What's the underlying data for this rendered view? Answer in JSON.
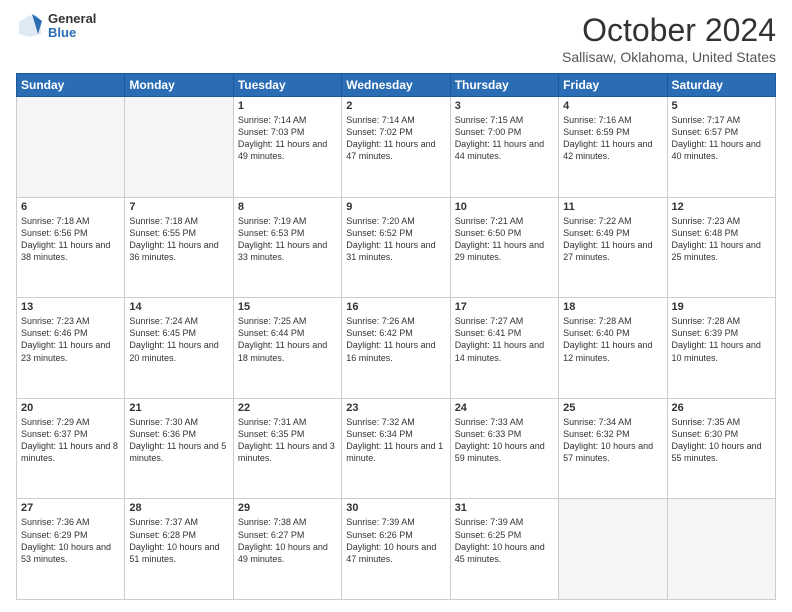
{
  "logo": {
    "general": "General",
    "blue": "Blue"
  },
  "header": {
    "month": "October 2024",
    "location": "Sallisaw, Oklahoma, United States"
  },
  "days_of_week": [
    "Sunday",
    "Monday",
    "Tuesday",
    "Wednesday",
    "Thursday",
    "Friday",
    "Saturday"
  ],
  "weeks": [
    [
      {
        "day": "",
        "sunrise": "",
        "sunset": "",
        "daylight": "",
        "empty": true
      },
      {
        "day": "",
        "sunrise": "",
        "sunset": "",
        "daylight": "",
        "empty": true
      },
      {
        "day": "1",
        "sunrise": "Sunrise: 7:14 AM",
        "sunset": "Sunset: 7:03 PM",
        "daylight": "Daylight: 11 hours and 49 minutes.",
        "empty": false
      },
      {
        "day": "2",
        "sunrise": "Sunrise: 7:14 AM",
        "sunset": "Sunset: 7:02 PM",
        "daylight": "Daylight: 11 hours and 47 minutes.",
        "empty": false
      },
      {
        "day": "3",
        "sunrise": "Sunrise: 7:15 AM",
        "sunset": "Sunset: 7:00 PM",
        "daylight": "Daylight: 11 hours and 44 minutes.",
        "empty": false
      },
      {
        "day": "4",
        "sunrise": "Sunrise: 7:16 AM",
        "sunset": "Sunset: 6:59 PM",
        "daylight": "Daylight: 11 hours and 42 minutes.",
        "empty": false
      },
      {
        "day": "5",
        "sunrise": "Sunrise: 7:17 AM",
        "sunset": "Sunset: 6:57 PM",
        "daylight": "Daylight: 11 hours and 40 minutes.",
        "empty": false
      }
    ],
    [
      {
        "day": "6",
        "sunrise": "Sunrise: 7:18 AM",
        "sunset": "Sunset: 6:56 PM",
        "daylight": "Daylight: 11 hours and 38 minutes.",
        "empty": false
      },
      {
        "day": "7",
        "sunrise": "Sunrise: 7:18 AM",
        "sunset": "Sunset: 6:55 PM",
        "daylight": "Daylight: 11 hours and 36 minutes.",
        "empty": false
      },
      {
        "day": "8",
        "sunrise": "Sunrise: 7:19 AM",
        "sunset": "Sunset: 6:53 PM",
        "daylight": "Daylight: 11 hours and 33 minutes.",
        "empty": false
      },
      {
        "day": "9",
        "sunrise": "Sunrise: 7:20 AM",
        "sunset": "Sunset: 6:52 PM",
        "daylight": "Daylight: 11 hours and 31 minutes.",
        "empty": false
      },
      {
        "day": "10",
        "sunrise": "Sunrise: 7:21 AM",
        "sunset": "Sunset: 6:50 PM",
        "daylight": "Daylight: 11 hours and 29 minutes.",
        "empty": false
      },
      {
        "day": "11",
        "sunrise": "Sunrise: 7:22 AM",
        "sunset": "Sunset: 6:49 PM",
        "daylight": "Daylight: 11 hours and 27 minutes.",
        "empty": false
      },
      {
        "day": "12",
        "sunrise": "Sunrise: 7:23 AM",
        "sunset": "Sunset: 6:48 PM",
        "daylight": "Daylight: 11 hours and 25 minutes.",
        "empty": false
      }
    ],
    [
      {
        "day": "13",
        "sunrise": "Sunrise: 7:23 AM",
        "sunset": "Sunset: 6:46 PM",
        "daylight": "Daylight: 11 hours and 23 minutes.",
        "empty": false
      },
      {
        "day": "14",
        "sunrise": "Sunrise: 7:24 AM",
        "sunset": "Sunset: 6:45 PM",
        "daylight": "Daylight: 11 hours and 20 minutes.",
        "empty": false
      },
      {
        "day": "15",
        "sunrise": "Sunrise: 7:25 AM",
        "sunset": "Sunset: 6:44 PM",
        "daylight": "Daylight: 11 hours and 18 minutes.",
        "empty": false
      },
      {
        "day": "16",
        "sunrise": "Sunrise: 7:26 AM",
        "sunset": "Sunset: 6:42 PM",
        "daylight": "Daylight: 11 hours and 16 minutes.",
        "empty": false
      },
      {
        "day": "17",
        "sunrise": "Sunrise: 7:27 AM",
        "sunset": "Sunset: 6:41 PM",
        "daylight": "Daylight: 11 hours and 14 minutes.",
        "empty": false
      },
      {
        "day": "18",
        "sunrise": "Sunrise: 7:28 AM",
        "sunset": "Sunset: 6:40 PM",
        "daylight": "Daylight: 11 hours and 12 minutes.",
        "empty": false
      },
      {
        "day": "19",
        "sunrise": "Sunrise: 7:28 AM",
        "sunset": "Sunset: 6:39 PM",
        "daylight": "Daylight: 11 hours and 10 minutes.",
        "empty": false
      }
    ],
    [
      {
        "day": "20",
        "sunrise": "Sunrise: 7:29 AM",
        "sunset": "Sunset: 6:37 PM",
        "daylight": "Daylight: 11 hours and 8 minutes.",
        "empty": false
      },
      {
        "day": "21",
        "sunrise": "Sunrise: 7:30 AM",
        "sunset": "Sunset: 6:36 PM",
        "daylight": "Daylight: 11 hours and 5 minutes.",
        "empty": false
      },
      {
        "day": "22",
        "sunrise": "Sunrise: 7:31 AM",
        "sunset": "Sunset: 6:35 PM",
        "daylight": "Daylight: 11 hours and 3 minutes.",
        "empty": false
      },
      {
        "day": "23",
        "sunrise": "Sunrise: 7:32 AM",
        "sunset": "Sunset: 6:34 PM",
        "daylight": "Daylight: 11 hours and 1 minute.",
        "empty": false
      },
      {
        "day": "24",
        "sunrise": "Sunrise: 7:33 AM",
        "sunset": "Sunset: 6:33 PM",
        "daylight": "Daylight: 10 hours and 59 minutes.",
        "empty": false
      },
      {
        "day": "25",
        "sunrise": "Sunrise: 7:34 AM",
        "sunset": "Sunset: 6:32 PM",
        "daylight": "Daylight: 10 hours and 57 minutes.",
        "empty": false
      },
      {
        "day": "26",
        "sunrise": "Sunrise: 7:35 AM",
        "sunset": "Sunset: 6:30 PM",
        "daylight": "Daylight: 10 hours and 55 minutes.",
        "empty": false
      }
    ],
    [
      {
        "day": "27",
        "sunrise": "Sunrise: 7:36 AM",
        "sunset": "Sunset: 6:29 PM",
        "daylight": "Daylight: 10 hours and 53 minutes.",
        "empty": false
      },
      {
        "day": "28",
        "sunrise": "Sunrise: 7:37 AM",
        "sunset": "Sunset: 6:28 PM",
        "daylight": "Daylight: 10 hours and 51 minutes.",
        "empty": false
      },
      {
        "day": "29",
        "sunrise": "Sunrise: 7:38 AM",
        "sunset": "Sunset: 6:27 PM",
        "daylight": "Daylight: 10 hours and 49 minutes.",
        "empty": false
      },
      {
        "day": "30",
        "sunrise": "Sunrise: 7:39 AM",
        "sunset": "Sunset: 6:26 PM",
        "daylight": "Daylight: 10 hours and 47 minutes.",
        "empty": false
      },
      {
        "day": "31",
        "sunrise": "Sunrise: 7:39 AM",
        "sunset": "Sunset: 6:25 PM",
        "daylight": "Daylight: 10 hours and 45 minutes.",
        "empty": false
      },
      {
        "day": "",
        "sunrise": "",
        "sunset": "",
        "daylight": "",
        "empty": true
      },
      {
        "day": "",
        "sunrise": "",
        "sunset": "",
        "daylight": "",
        "empty": true
      }
    ]
  ]
}
